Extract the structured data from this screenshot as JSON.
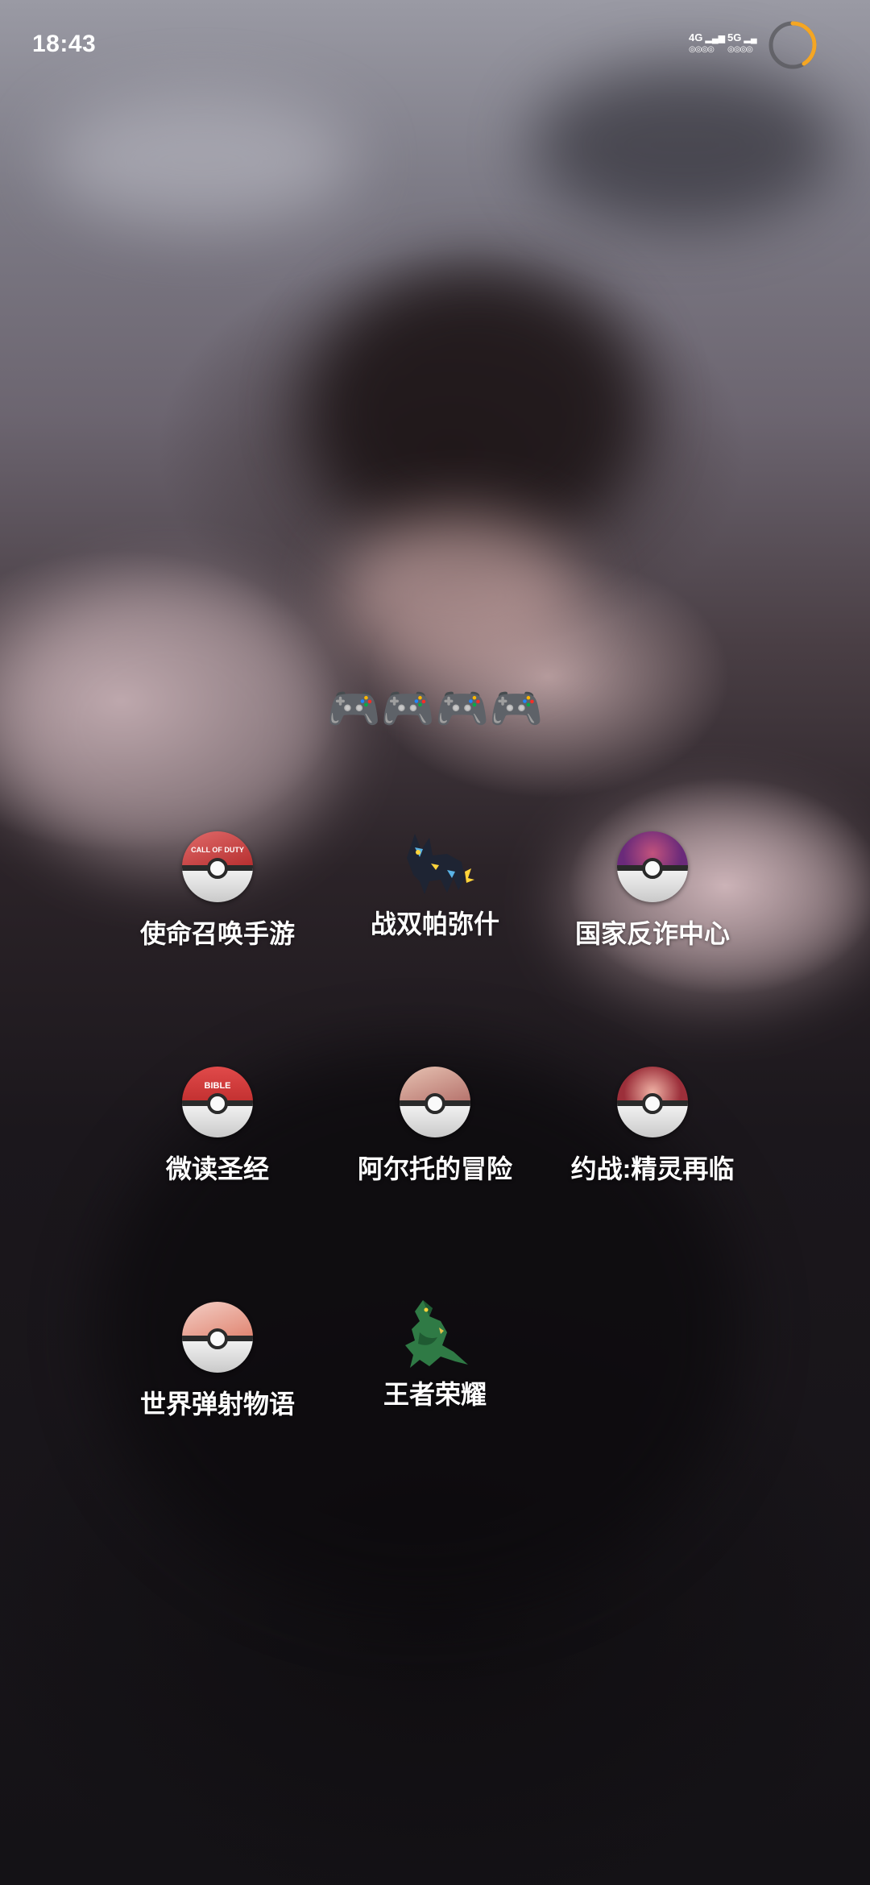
{
  "status_bar": {
    "time": "18:43",
    "network_1": "4G",
    "network_2": "5G",
    "battery_ring_color": "#f5a623"
  },
  "folder": {
    "title": "🎮🎮🎮🎮"
  },
  "apps": [
    {
      "label": "使命召唤手游",
      "icon": "call-of-duty-pokeball-icon",
      "tag": "CALL OF DUTY"
    },
    {
      "label": "战双帕弥什",
      "icon": "luxray-pokemon-icon"
    },
    {
      "label": "国家反诈中心",
      "icon": "anti-fraud-center-pokeball-icon"
    },
    {
      "label": "微读圣经",
      "icon": "bible-pokeball-icon",
      "tag": "BIBLE"
    },
    {
      "label": "阿尔托的冒险",
      "icon": "altos-adventure-pokeball-icon"
    },
    {
      "label": "约战:精灵再临",
      "icon": "date-a-live-pokeball-icon"
    },
    {
      "label": "世界弹射物语",
      "icon": "world-flipper-pokeball-icon"
    },
    {
      "label": "王者荣耀",
      "icon": "rayquaza-pokemon-icon"
    }
  ]
}
